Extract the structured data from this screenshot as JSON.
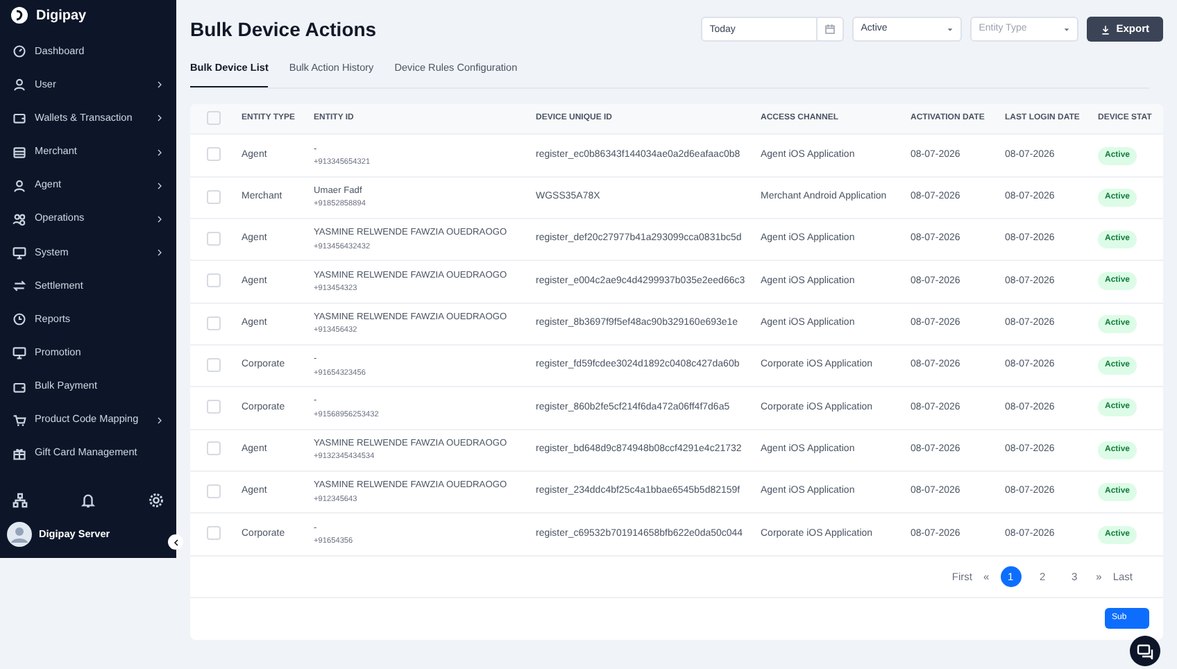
{
  "brand": "Digipay",
  "sidebar": {
    "items": [
      {
        "label": "Dashboard",
        "expandable": false
      },
      {
        "label": "User",
        "expandable": true
      },
      {
        "label": "Wallets & Transaction",
        "expandable": true
      },
      {
        "label": "Merchant",
        "expandable": true
      },
      {
        "label": "Agent",
        "expandable": true
      },
      {
        "label": "Operations",
        "expandable": true
      },
      {
        "label": "System",
        "expandable": true
      },
      {
        "label": "Settlement",
        "expandable": false
      },
      {
        "label": "Reports",
        "expandable": false
      },
      {
        "label": "Promotion",
        "expandable": false
      },
      {
        "label": "Bulk Payment",
        "expandable": false
      },
      {
        "label": "Product Code Mapping",
        "expandable": true
      },
      {
        "label": "Gift Card Management",
        "expandable": false
      }
    ],
    "user": "Digipay Server"
  },
  "page_title": "Bulk Device Actions",
  "filters": {
    "date": "Today",
    "status": "Active",
    "entity_type_placeholder": "Entity Type",
    "export": "Export"
  },
  "tabs": [
    {
      "label": "Bulk Device List",
      "selected": true
    },
    {
      "label": "Bulk Action History",
      "selected": false
    },
    {
      "label": "Device Rules Configuration",
      "selected": false
    }
  ],
  "table": {
    "header_checked": false,
    "columns": [
      "ENTITY TYPE",
      "ENTITY ID",
      "DEVICE UNIQUE ID",
      "ACCESS CHANNEL",
      "ACTIVATION DATE",
      "LAST LOGIN DATE",
      "DEVICE STAT"
    ],
    "rows": [
      {
        "checked": false,
        "entity_type": "Agent",
        "name": "-",
        "phone": "+913345654321",
        "device_id": "register_ec0b86343f144034ae0a2d6eafaac0b8",
        "channel": "Agent iOS Application",
        "activation": "08-07-2026",
        "last_login": "08-07-2026",
        "status": "Active"
      },
      {
        "checked": false,
        "entity_type": "Merchant",
        "name": "Umaer Fadf",
        "phone": "+91852858894",
        "device_id": "WGSS35A78X",
        "channel": "Merchant Android Application",
        "activation": "08-07-2026",
        "last_login": "08-07-2026",
        "status": "Active"
      },
      {
        "checked": false,
        "entity_type": "Agent",
        "name": "YASMINE RELWENDE FAWZIA OUEDRAOGO",
        "phone": "+913456432432",
        "device_id": "register_def20c27977b41a293099cca0831bc5d",
        "channel": "Agent iOS Application",
        "activation": "08-07-2026",
        "last_login": "08-07-2026",
        "status": "Active"
      },
      {
        "checked": false,
        "entity_type": "Agent",
        "name": "YASMINE RELWENDE FAWZIA OUEDRAOGO",
        "phone": "+913454323",
        "device_id": "register_e004c2ae9c4d4299937b035e2eed66c3",
        "channel": "Agent iOS Application",
        "activation": "08-07-2026",
        "last_login": "08-07-2026",
        "status": "Active"
      },
      {
        "checked": false,
        "entity_type": "Agent",
        "name": "YASMINE RELWENDE FAWZIA OUEDRAOGO",
        "phone": "+913456432",
        "device_id": "register_8b3697f9f5ef48ac90b329160e693e1e",
        "channel": "Agent iOS Application",
        "activation": "08-07-2026",
        "last_login": "08-07-2026",
        "status": "Active"
      },
      {
        "checked": false,
        "entity_type": "Corporate",
        "name": "-",
        "phone": "+91654323456",
        "device_id": "register_fd59fcdee3024d1892c0408c427da60b",
        "channel": "Corporate iOS Application",
        "activation": "08-07-2026",
        "last_login": "08-07-2026",
        "status": "Active"
      },
      {
        "checked": false,
        "entity_type": "Corporate",
        "name": "-",
        "phone": "+91568956253432",
        "device_id": "register_860b2fe5cf214f6da472a06ff4f7d6a5",
        "channel": "Corporate iOS Application",
        "activation": "08-07-2026",
        "last_login": "08-07-2026",
        "status": "Active"
      },
      {
        "checked": false,
        "entity_type": "Agent",
        "name": "YASMINE RELWENDE FAWZIA OUEDRAOGO",
        "phone": "+9132345434534",
        "device_id": "register_bd648d9c874948b08ccf4291e4c21732",
        "channel": "Agent iOS Application",
        "activation": "08-07-2026",
        "last_login": "08-07-2026",
        "status": "Active"
      },
      {
        "checked": false,
        "entity_type": "Agent",
        "name": "YASMINE RELWENDE FAWZIA OUEDRAOGO",
        "phone": "+912345643",
        "device_id": "register_234ddc4bf25c4a1bbae6545b5d82159f",
        "channel": "Agent iOS Application",
        "activation": "08-07-2026",
        "last_login": "08-07-2026",
        "status": "Active"
      },
      {
        "checked": false,
        "entity_type": "Corporate",
        "name": "-",
        "phone": "+91654356",
        "device_id": "register_c69532b701914658bfb622e0da50c044",
        "channel": "Corporate iOS Application",
        "activation": "08-07-2026",
        "last_login": "08-07-2026",
        "status": "Active"
      }
    ]
  },
  "pagination": {
    "first": "First",
    "prev": "«",
    "pages": [
      {
        "label": "1",
        "selected": true
      },
      {
        "label": "2",
        "selected": false
      },
      {
        "label": "3",
        "selected": false
      }
    ],
    "next": "»",
    "last": "Last"
  },
  "submit": "Sub"
}
